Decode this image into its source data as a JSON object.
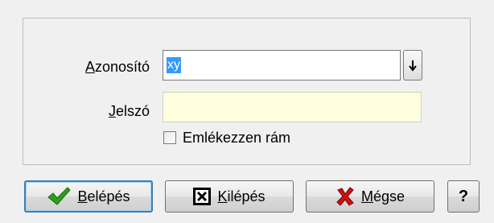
{
  "form": {
    "username_label_key": "A",
    "username_label_rest": "zonosító",
    "username_value": "xy",
    "password_label_key": "J",
    "password_label_rest": "elszó",
    "password_value": "",
    "remember_label": "Emlékezzen rám",
    "remember_checked": false
  },
  "buttons": {
    "login_key": "B",
    "login_rest": "elépés",
    "exit_key": "K",
    "exit_rest": "ilépés",
    "cancel_key": "M",
    "cancel_rest": "égse",
    "help_label": "?"
  },
  "icons": {
    "login": "checkmark-icon",
    "exit": "close-box-icon",
    "cancel": "red-x-icon",
    "dropdown": "down-arrow-icon"
  },
  "colors": {
    "selection": "#3399ff",
    "password_bg": "#ffffe0",
    "check_green": "#2e9e1e",
    "cancel_red": "#cc1010"
  }
}
